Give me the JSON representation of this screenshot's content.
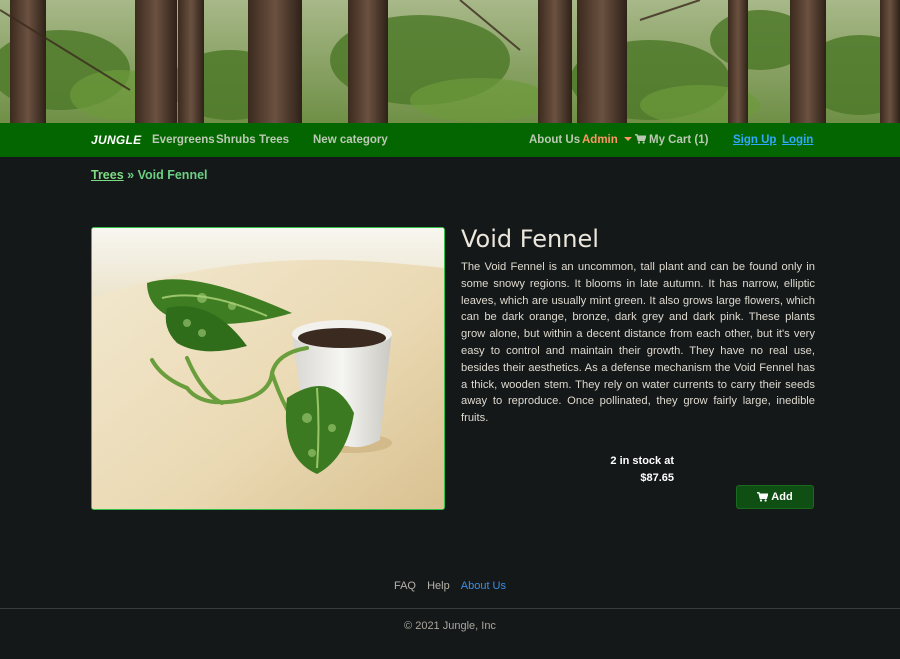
{
  "navbar": {
    "brand": "JUNGLE",
    "categories": [
      "Evergreens",
      "Shrubs",
      "Trees"
    ],
    "new_category": "New category",
    "about": "About Us",
    "admin": "Admin",
    "cart": "My Cart (1)",
    "signup": "Sign Up",
    "login": "Login"
  },
  "breadcrumb": {
    "parent": "Trees",
    "separator": "»",
    "current": "Void Fennel"
  },
  "product": {
    "name": "Void Fennel",
    "description": "The Void Fennel is an uncommon, tall plant and can be found only in some snowy regions. It blooms in late autumn. It has narrow, elliptic leaves, which are usually mint green. It also grows large flowers, which can be dark orange, bronze, dark grey and dark pink. These plants grow alone, but within a decent distance from each other, but it's very easy to control and maintain their growth. They have no real use, besides their aesthetics. As a defense mechanism the Void Fennel has a thick, wooden stem. They rely on water currents to carry their seeds away to reproduce. Once pollinated, they grow fairly large, inedible fruits.",
    "stock_line": "2 in stock at",
    "price": "$87.65",
    "add_label": "Add"
  },
  "footer": {
    "links": [
      "FAQ",
      "Help",
      "About Us"
    ],
    "copyright": "© 2021 Jungle, Inc"
  },
  "colors": {
    "navbar_bg": "#046600",
    "page_bg": "#151819",
    "admin_accent": "#ff9565",
    "link_blue": "#2fa9ff",
    "add_button_bg": "#0f4f14"
  }
}
